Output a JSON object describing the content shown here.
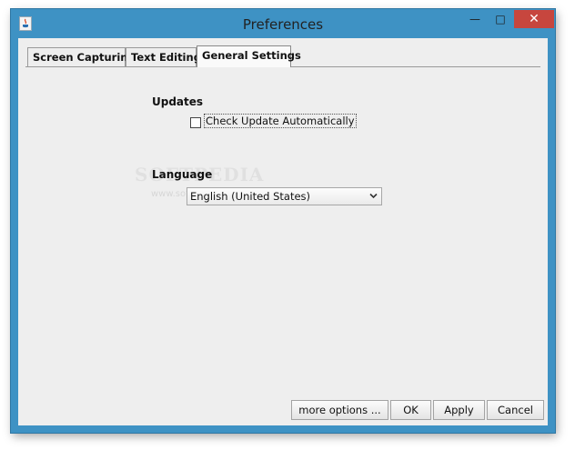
{
  "window": {
    "title": "Preferences"
  },
  "tabs": [
    {
      "label": "Screen Capturing",
      "selected": false
    },
    {
      "label": "Text Editing",
      "selected": false
    },
    {
      "label": "General Settings",
      "selected": true
    }
  ],
  "updates": {
    "title": "Updates",
    "checkbox_label": "Check Update Automatically",
    "checked": false
  },
  "language": {
    "title": "Language",
    "selected": "English (United States)"
  },
  "watermark": {
    "text": "SOFTPEDIA",
    "url": "www.softpedia.com"
  },
  "buttons": {
    "more_options": "more options ...",
    "ok": "OK",
    "apply": "Apply",
    "cancel": "Cancel"
  },
  "colors": {
    "titlebar": "#3e92c4",
    "close_button": "#c7463e",
    "client_background": "#eeeeee"
  }
}
